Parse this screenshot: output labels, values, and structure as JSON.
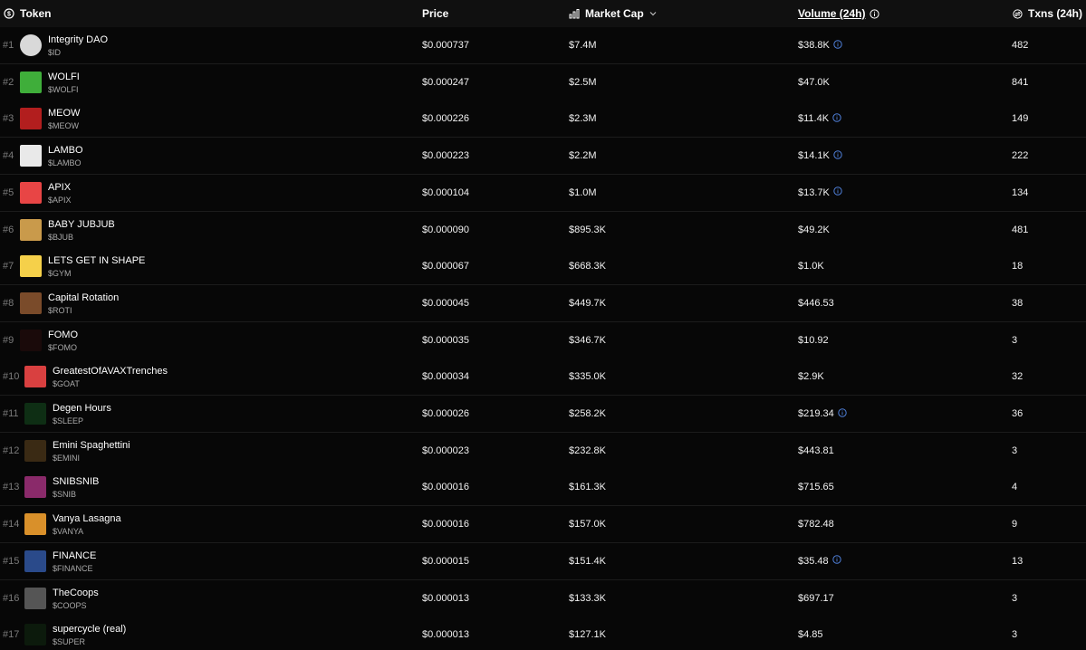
{
  "header": {
    "token": "Token",
    "price": "Price",
    "market_cap": "Market Cap",
    "volume": "Volume (24h)",
    "txns": "Txns (24h)"
  },
  "colors": {
    "background": "#000000",
    "header_bg": "#101010",
    "info_icon": "#4f7fd8",
    "muted_text": "#a9a9a9"
  },
  "rows": [
    {
      "rank": "#1",
      "name": "Integrity DAO",
      "symbol": "$ID",
      "price": "$0.000737",
      "market_cap": "$7.4M",
      "volume": "$38.8K",
      "volume_info": true,
      "txns": "482",
      "thumb_color": "#d9d9d9",
      "thumb_text": "",
      "thumb_shape": "circle"
    },
    {
      "rank": "#2",
      "name": "WOLFI",
      "symbol": "$WOLFI",
      "price": "$0.000247",
      "market_cap": "$2.5M",
      "volume": "$47.0K",
      "volume_info": false,
      "txns": "841",
      "thumb_color": "#3fae3a",
      "thumb_text": "",
      "thumb_shape": "square"
    },
    {
      "rank": "#3",
      "name": "MEOW",
      "symbol": "$MEOW",
      "price": "$0.000226",
      "market_cap": "$2.3M",
      "volume": "$11.4K",
      "volume_info": true,
      "txns": "149",
      "thumb_color": "#b21e1e",
      "thumb_text": "",
      "thumb_shape": "square"
    },
    {
      "rank": "#4",
      "name": "LAMBO",
      "symbol": "$LAMBO",
      "price": "$0.000223",
      "market_cap": "$2.2M",
      "volume": "$14.1K",
      "volume_info": true,
      "txns": "222",
      "thumb_color": "#e9e9e9",
      "thumb_text": "",
      "thumb_shape": "square"
    },
    {
      "rank": "#5",
      "name": "APIX",
      "symbol": "$APIX",
      "price": "$0.000104",
      "market_cap": "$1.0M",
      "volume": "$13.7K",
      "volume_info": true,
      "txns": "134",
      "thumb_color": "#e84545",
      "thumb_text": "",
      "thumb_shape": "square"
    },
    {
      "rank": "#6",
      "name": "BABY JUBJUB",
      "symbol": "$BJUB",
      "price": "$0.000090",
      "market_cap": "$895.3K",
      "volume": "$49.2K",
      "volume_info": false,
      "txns": "481",
      "thumb_color": "#c99a4b",
      "thumb_text": "",
      "thumb_shape": "square"
    },
    {
      "rank": "#7",
      "name": "LETS GET IN SHAPE",
      "symbol": "$GYM",
      "price": "$0.000067",
      "market_cap": "$668.3K",
      "volume": "$1.0K",
      "volume_info": false,
      "txns": "18",
      "thumb_color": "#f5d04a",
      "thumb_text": "",
      "thumb_shape": "square"
    },
    {
      "rank": "#8",
      "name": "Capital Rotation",
      "symbol": "$ROTI",
      "price": "$0.000045",
      "market_cap": "$449.7K",
      "volume": "$446.53",
      "volume_info": false,
      "txns": "38",
      "thumb_color": "#7a4b2a",
      "thumb_text": "",
      "thumb_shape": "square"
    },
    {
      "rank": "#9",
      "name": "FOMO",
      "symbol": "$FOMO",
      "price": "$0.000035",
      "market_cap": "$346.7K",
      "volume": "$10.92",
      "volume_info": false,
      "txns": "3",
      "thumb_color": "#1a0a0a",
      "thumb_text": "",
      "thumb_shape": "square"
    },
    {
      "rank": "#10",
      "name": "GreatestOfAVAXTrenches",
      "symbol": "$GOAT",
      "price": "$0.000034",
      "market_cap": "$335.0K",
      "volume": "$2.9K",
      "volume_info": false,
      "txns": "32",
      "thumb_color": "#d94040",
      "thumb_text": "",
      "thumb_shape": "square"
    },
    {
      "rank": "#11",
      "name": "Degen Hours",
      "symbol": "$SLEEP",
      "price": "$0.000026",
      "market_cap": "$258.2K",
      "volume": "$219.34",
      "volume_info": true,
      "txns": "36",
      "thumb_color": "#0e2e14",
      "thumb_text": "",
      "thumb_shape": "square"
    },
    {
      "rank": "#12",
      "name": "Emini Spaghettini",
      "symbol": "$EMINI",
      "price": "$0.000023",
      "market_cap": "$232.8K",
      "volume": "$443.81",
      "volume_info": false,
      "txns": "3",
      "thumb_color": "#3a2a14",
      "thumb_text": "",
      "thumb_shape": "square"
    },
    {
      "rank": "#13",
      "name": "SNIBSNIB",
      "symbol": "$SNIB",
      "price": "$0.000016",
      "market_cap": "$161.3K",
      "volume": "$715.65",
      "volume_info": false,
      "txns": "4",
      "thumb_color": "#8a2a6a",
      "thumb_text": "",
      "thumb_shape": "square"
    },
    {
      "rank": "#14",
      "name": "Vanya Lasagna",
      "symbol": "$VANYA",
      "price": "$0.000016",
      "market_cap": "$157.0K",
      "volume": "$782.48",
      "volume_info": false,
      "txns": "9",
      "thumb_color": "#d9902a",
      "thumb_text": "",
      "thumb_shape": "square"
    },
    {
      "rank": "#15",
      "name": "FINANCE",
      "symbol": "$FINANCE",
      "price": "$0.000015",
      "market_cap": "$151.4K",
      "volume": "$35.48",
      "volume_info": true,
      "txns": "13",
      "thumb_color": "#2a4a8a",
      "thumb_text": "",
      "thumb_shape": "square"
    },
    {
      "rank": "#16",
      "name": "TheCoops",
      "symbol": "$COOPS",
      "price": "$0.000013",
      "market_cap": "$133.3K",
      "volume": "$697.17",
      "volume_info": false,
      "txns": "3",
      "thumb_color": "#555555",
      "thumb_text": "",
      "thumb_shape": "square"
    },
    {
      "rank": "#17",
      "name": "supercycle (real)",
      "symbol": "$SUPER",
      "price": "$0.000013",
      "market_cap": "$127.1K",
      "volume": "$4.85",
      "volume_info": false,
      "txns": "3",
      "thumb_color": "#0c1a0c",
      "thumb_text": "",
      "thumb_shape": "square"
    }
  ]
}
